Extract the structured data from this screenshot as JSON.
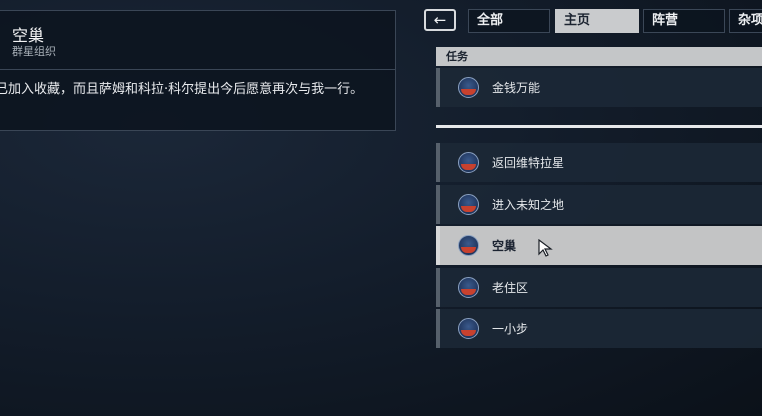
{
  "detail": {
    "title": "空巢",
    "subtitle": "群星组织",
    "text": "已加入收藏，而且萨姆和科拉·科尔提出今后愿意再次与我一行。"
  },
  "tabs": [
    {
      "label": "全部",
      "active": false
    },
    {
      "label": "主页",
      "active": true
    },
    {
      "label": "阵营",
      "active": false
    },
    {
      "label": "杂项",
      "active": false
    }
  ],
  "back_icon": "arrow-left-icon",
  "active_section": {
    "header": "任务",
    "items": [
      {
        "label": "金钱万能"
      }
    ]
  },
  "completed_items": [
    {
      "label": "返回维特拉星",
      "selected": false
    },
    {
      "label": "进入未知之地",
      "selected": false
    },
    {
      "label": "空巢",
      "selected": true
    },
    {
      "label": "老住区",
      "selected": false
    },
    {
      "label": "一小步",
      "selected": false
    }
  ],
  "colors": {
    "accent_selected": "#c3c4c5",
    "panel_bg": "#1c2836",
    "mission_icon_red": "#c8412e"
  }
}
